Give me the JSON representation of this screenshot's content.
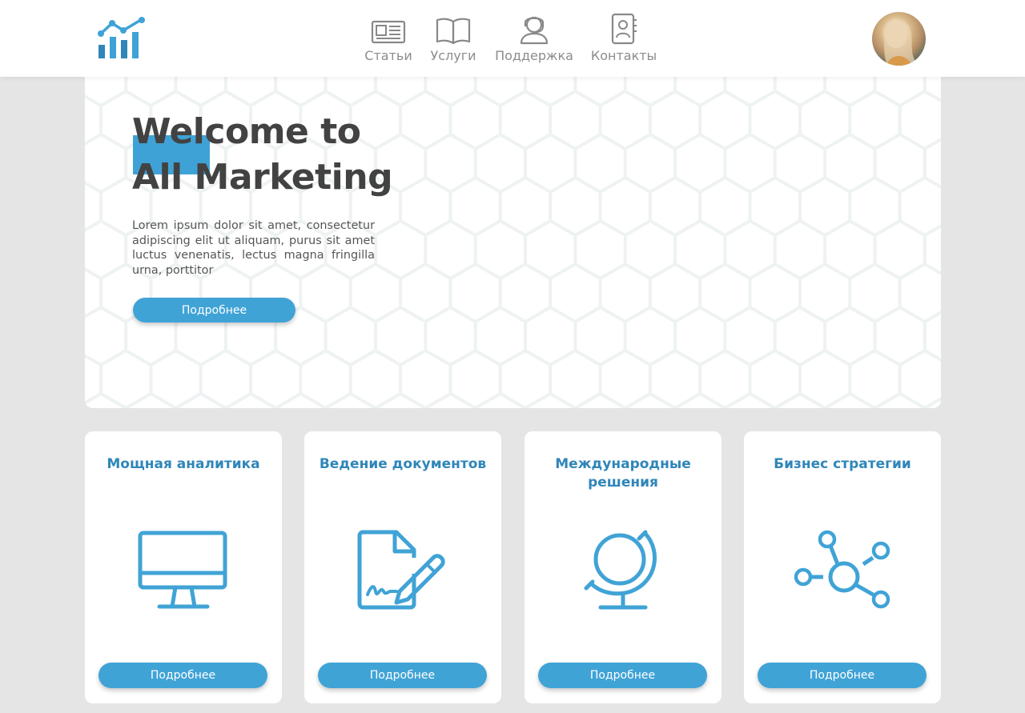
{
  "header": {
    "logo_icon": "bar-chart-trend-icon",
    "nav": [
      {
        "label": "Статьи",
        "icon": "newspaper-icon"
      },
      {
        "label": "Услуги",
        "icon": "open-book-icon"
      },
      {
        "label": "Поддержка",
        "icon": "support-headset-icon"
      },
      {
        "label": "Контакты",
        "icon": "contact-book-icon"
      }
    ],
    "avatar": "user-avatar"
  },
  "hero": {
    "title_line1": "Welcome to",
    "title_line2": "All Marketing",
    "text": "Lorem ipsum dolor sit amet, consectetur adipiscing elit ut aliquam, purus sit amet luctus venenatis, lectus magna fringilla urna, porttitor",
    "button": "Подробнее"
  },
  "cards": [
    {
      "title": "Мощная аналитика",
      "icon": "monitor-icon",
      "button": "Подробнее"
    },
    {
      "title": "Ведение документов",
      "icon": "document-sign-icon",
      "button": "Подробнее"
    },
    {
      "title": "Международные решения",
      "icon": "globe-icon",
      "button": "Подробнее"
    },
    {
      "title": "Бизнес стратегии",
      "icon": "network-nodes-icon",
      "button": "Подробнее"
    }
  ],
  "colors": {
    "accent": "#40a3d6",
    "title_blue": "#2f86b9",
    "text_dark": "#424242",
    "nav_gray": "#8c8c8c",
    "page_bg": "#e5e5e5"
  }
}
